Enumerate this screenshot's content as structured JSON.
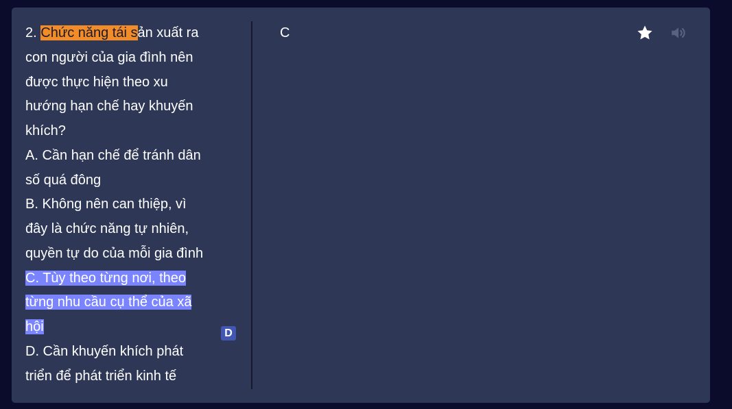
{
  "card": {
    "question_lines": [
      "2. ",
      "Chức năng tái s",
      "ản xuất ra",
      "con người của gia đình nên",
      "được thực hiện theo xu",
      "hướng hạn chế hay khuyến",
      "khích?",
      "A. Cần hạn chế để tránh dân",
      "số quá đông",
      "B. Không nên can thiệp, vì",
      "đây là chức năng tự nhiên,",
      "quyền tự do của mỗi gia đình",
      "C. Tùy theo từng nơi, theo",
      "từng nhu cầu cụ thể của xã",
      "hội",
      "D. Cần khuyến khích phát",
      "triển để phát triển kinh tế"
    ],
    "answer": "C",
    "badge": "D"
  },
  "icons": {
    "star": "star-icon",
    "audio": "speaker-icon"
  },
  "colors": {
    "background": "#0b0b2b",
    "card": "#2e3856",
    "highlight_orange": "#f28c28",
    "highlight_blue": "#7b84ff",
    "badge": "#4257b2",
    "icon_disabled": "#586380"
  }
}
